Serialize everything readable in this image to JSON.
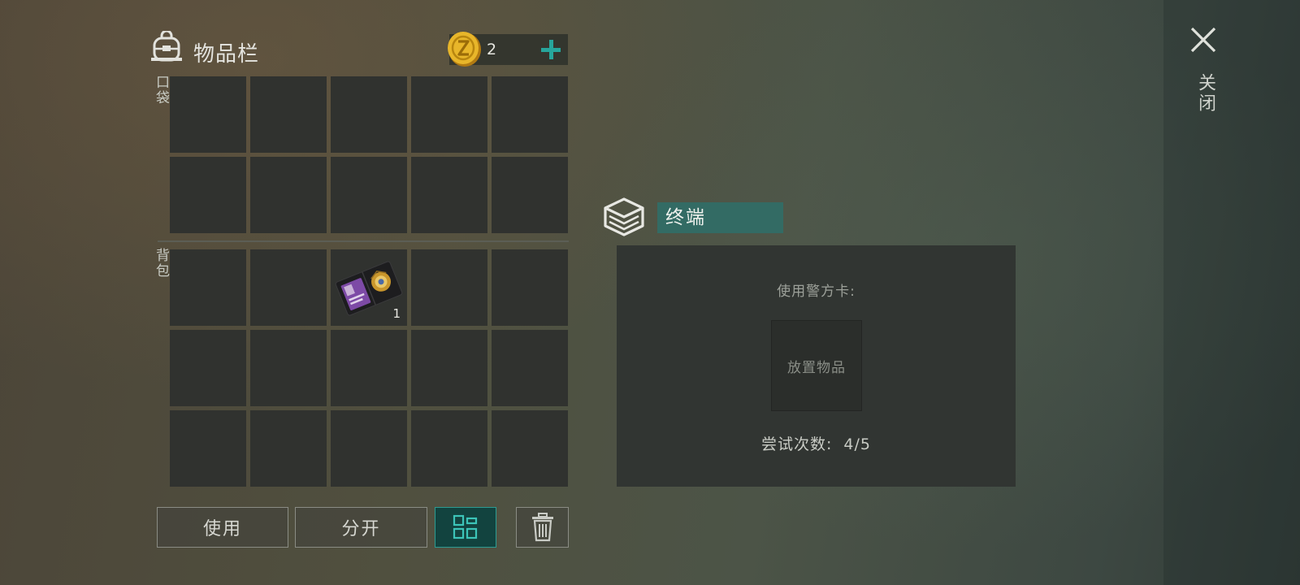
{
  "inventory": {
    "title": "物品栏",
    "coins": "2",
    "pocket_label": "口袋",
    "backpack_label": "背包",
    "item_qty": "1",
    "buttons": {
      "use": "使用",
      "split": "分开"
    }
  },
  "terminal": {
    "title": "终端",
    "use_card_label": "使用警方卡:",
    "drop_placeholder": "放置物品",
    "attempts_label": "尝试次数:",
    "attempts_value": "4/5"
  },
  "close_label": "关闭",
  "icons": [
    "backpack-icon",
    "coin-icon",
    "plus-icon",
    "police-badge-icon",
    "sort-grid-icon",
    "trash-icon",
    "terminal-box-icon",
    "close-icon"
  ],
  "colors": {
    "accent": "#2d9b92",
    "title_bg": "#336b64",
    "slot_bg": "#30322f"
  }
}
